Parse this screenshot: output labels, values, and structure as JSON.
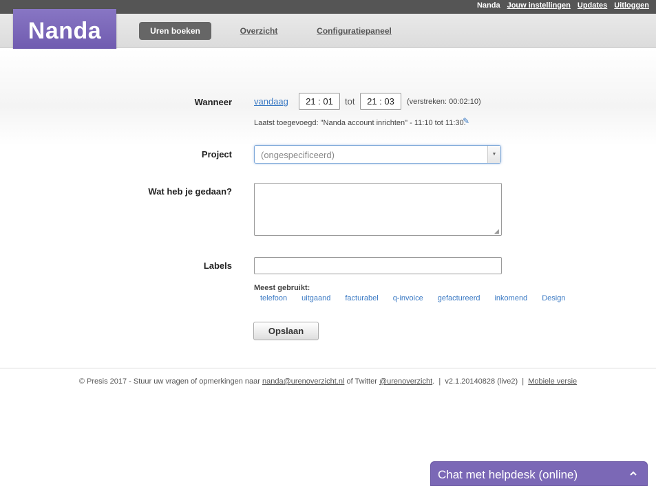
{
  "topbar": {
    "user": "Nanda",
    "links": [
      "Jouw instellingen",
      "Updates",
      "Uitloggen"
    ]
  },
  "logo": {
    "text": "Nanda"
  },
  "nav": {
    "active": "Uren boeken",
    "overzicht": "Overzicht",
    "config": "Configuratiepaneel"
  },
  "form": {
    "wanneer_label": "Wanneer",
    "vandaag": "vandaag",
    "start_time": "21 : 01",
    "tot": "tot",
    "end_time": "21 : 03",
    "elapsed": "(verstreken: 00:02:10)",
    "last_added": "Laatst toegevoegd: \"Nanda account inrichten\" - 11:10 tot 11:30.",
    "project_label": "Project",
    "project_value": "(ongespecificeerd)",
    "wat_label": "Wat heb je gedaan?",
    "wat_value": "",
    "labels_label": "Labels",
    "labels_value": "",
    "most_used_title": "Meest gebruikt:",
    "tags": [
      "telefoon",
      "uitgaand",
      "facturabel",
      "q-invoice",
      "gefactureerd",
      "inkomend",
      "Design"
    ],
    "save_label": "Opslaan"
  },
  "footer": {
    "prefix": "© Presis 2017 - Stuur uw vragen of opmerkingen naar",
    "email": "nanda@urenoverzicht.nl",
    "twitter_prefix": "of Twitter",
    "twitter": "@urenoverzicht",
    "version": "v2.1.20140828 (live2)",
    "mobile": "Mobiele versie"
  },
  "chat": {
    "title": "Chat met helpdesk (online)"
  },
  "colors": {
    "accent": "#7b68b6",
    "link": "#3b7ac4",
    "topbar": "#555555"
  }
}
